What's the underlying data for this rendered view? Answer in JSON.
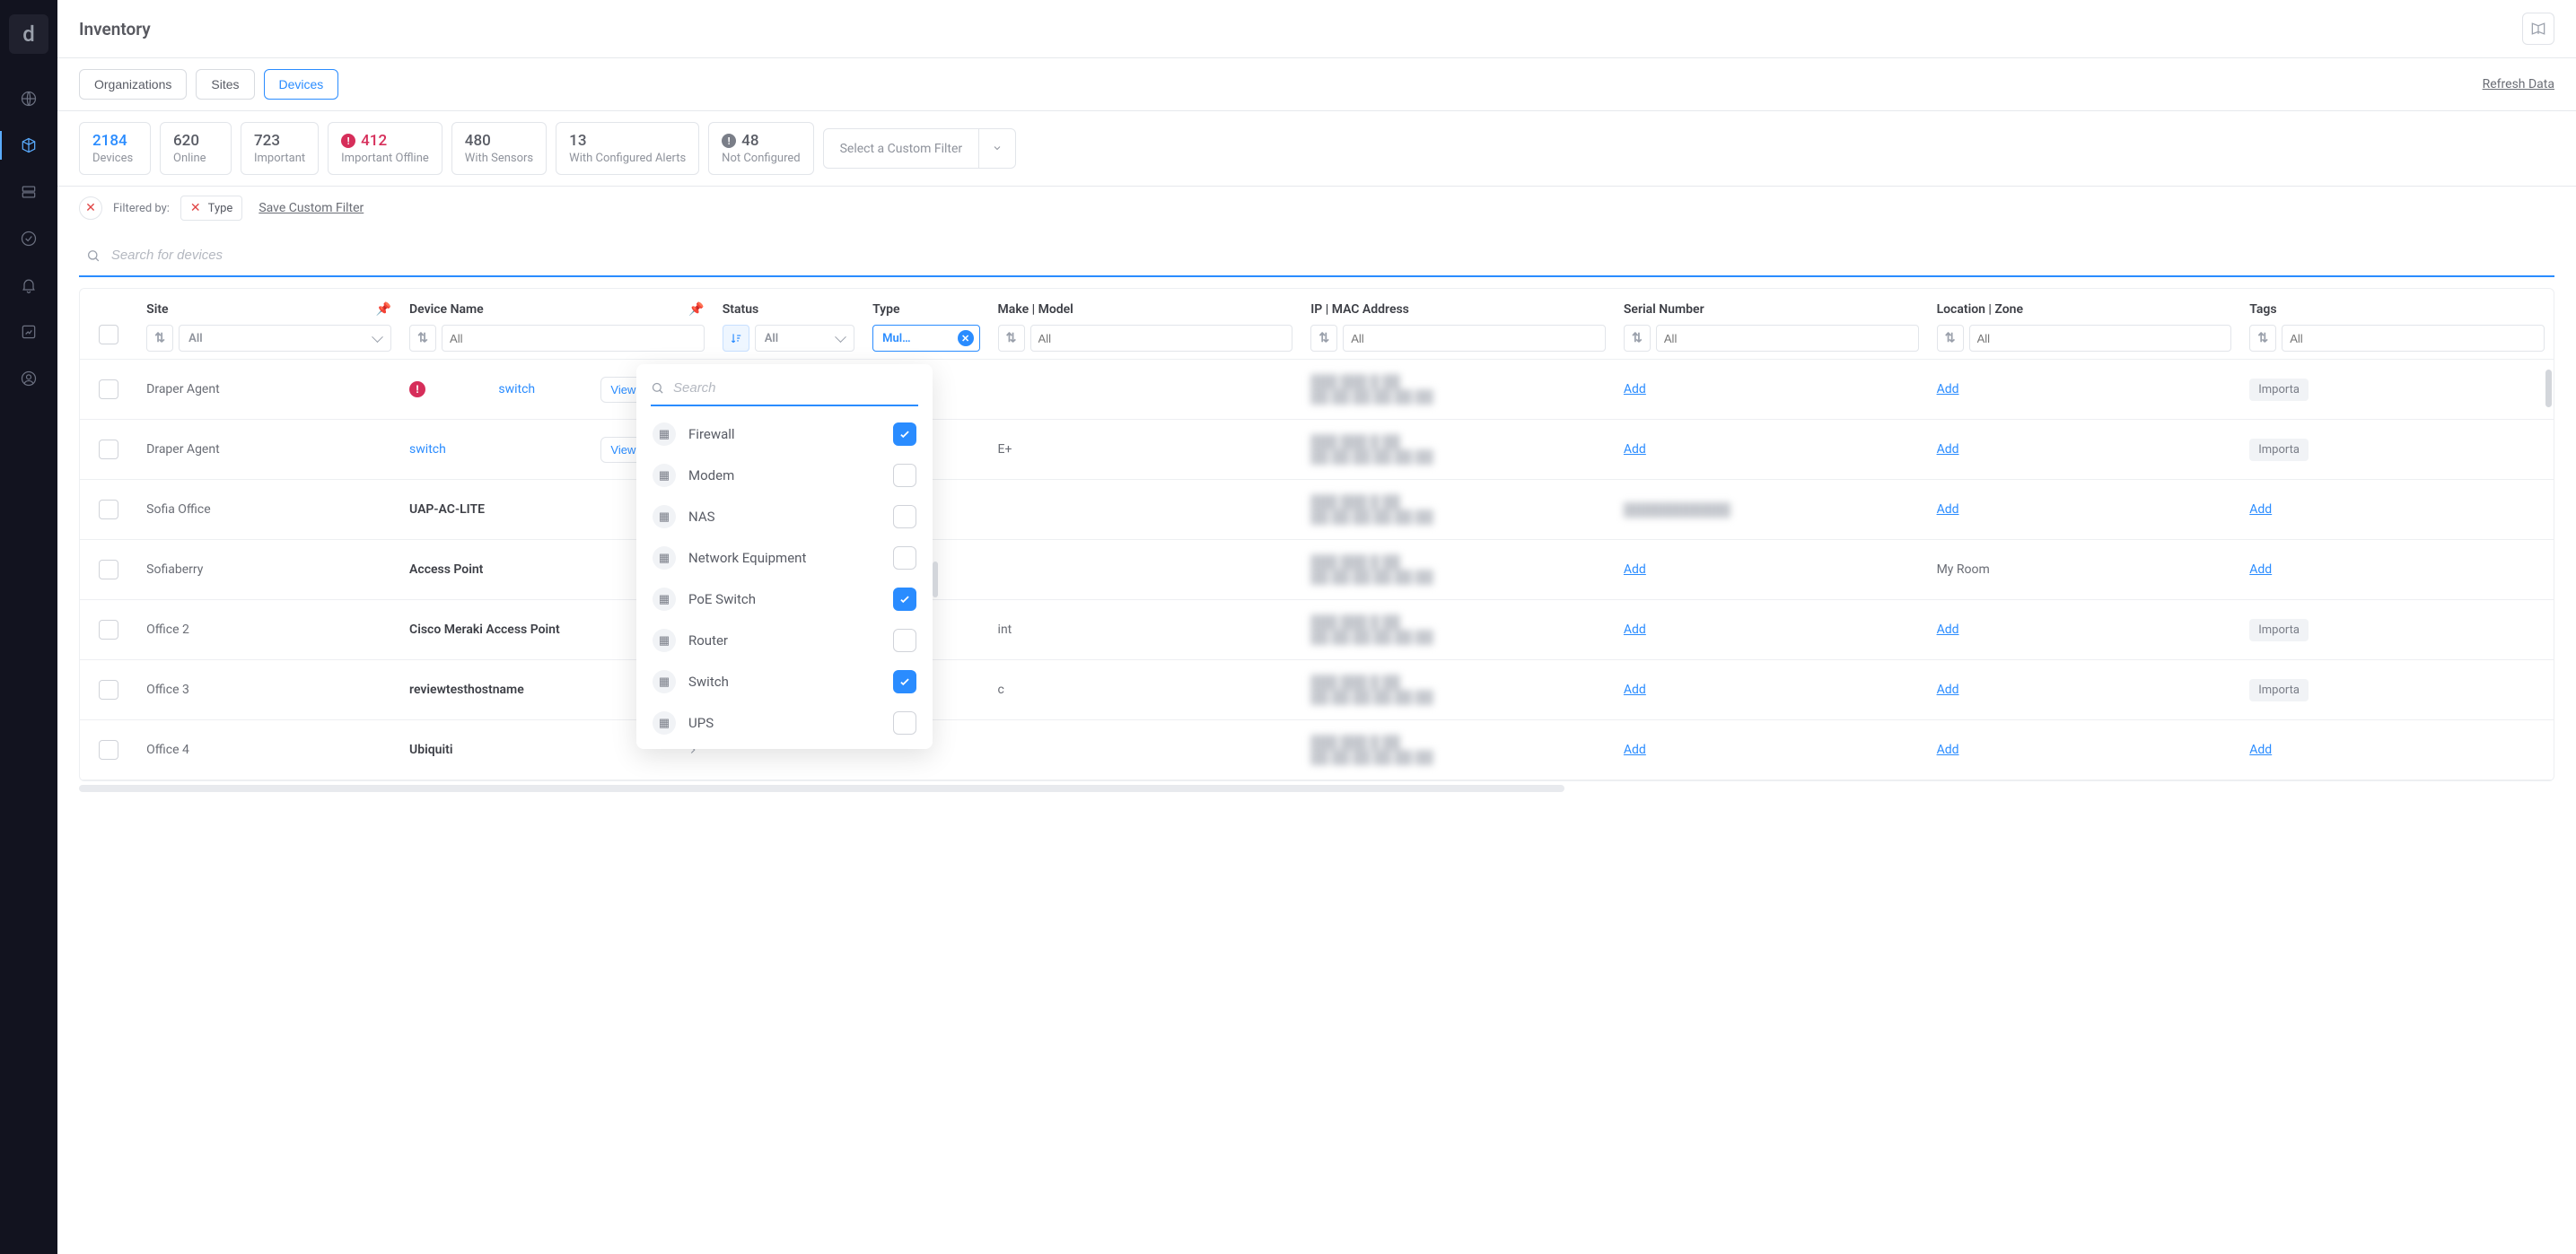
{
  "page": {
    "title": "Inventory",
    "refresh": "Refresh Data"
  },
  "tabs": {
    "organizations": "Organizations",
    "sites": "Sites",
    "devices": "Devices"
  },
  "stats": {
    "devices": {
      "num": "2184",
      "label": "Devices"
    },
    "online": {
      "num": "620",
      "label": "Online"
    },
    "important": {
      "num": "723",
      "label": "Important"
    },
    "important_offline": {
      "num": "412",
      "label": "Important Offline"
    },
    "with_sensors": {
      "num": "480",
      "label": "With Sensors"
    },
    "with_alerts": {
      "num": "13",
      "label": "With Configured Alerts"
    },
    "not_configured": {
      "num": "48",
      "label": "Not Configured"
    }
  },
  "filter_dropdown": "Select a Custom Filter",
  "filter": {
    "filtered_by": "Filtered by:",
    "type_chip": "Type",
    "save": "Save Custom Filter"
  },
  "search_placeholder": "Search for devices",
  "columns": {
    "site": "Site",
    "device_name": "Device Name",
    "status": "Status",
    "type": "Type",
    "make_model": "Make | Model",
    "ip_mac": "IP | MAC Address",
    "serial": "Serial Number",
    "location": "Location | Zone",
    "tags": "Tags"
  },
  "col_filters": {
    "all": "All",
    "type_multi": "Mul…"
  },
  "view_details": "View Details",
  "add": "Add",
  "tag_important": "Importa",
  "rows": [
    {
      "site": "Draper Agent",
      "device": "switch",
      "link": true,
      "alert": true,
      "view": true,
      "make_partial": "",
      "serial_add": true,
      "loc_add": true,
      "tag": true
    },
    {
      "site": "Draper Agent",
      "device": "switch",
      "link": true,
      "alert": false,
      "view": true,
      "make_partial": "E+",
      "serial_add": true,
      "loc_add": true,
      "tag": true
    },
    {
      "site": "Sofia Office",
      "device": "UAP-AC-LITE",
      "link": false,
      "alert": false,
      "view": false,
      "make_partial": "",
      "serial_blur": true,
      "loc_add": true,
      "tag_add": true
    },
    {
      "site": "Sofiaberry",
      "device": "Access Point",
      "link": false,
      "alert": false,
      "view": false,
      "make_partial": "",
      "serial_add": true,
      "loc_text": "My Room",
      "tag_add": true
    },
    {
      "site": "Office 2",
      "device": "Cisco Meraki Access Point",
      "link": false,
      "alert": false,
      "view": false,
      "make_partial": "int",
      "serial_add": true,
      "loc_add": true,
      "tag": true
    },
    {
      "site": "Office 3",
      "device": "reviewtesthostname",
      "link": false,
      "alert": false,
      "view": false,
      "make_partial": "c",
      "serial_add": true,
      "loc_add": true,
      "tag": true
    },
    {
      "site": "Office 4",
      "device": "Ubiquiti",
      "link": false,
      "alert": false,
      "view": false,
      "make_partial": "",
      "serial_add": true,
      "loc_add": true,
      "tag_add": true
    }
  ],
  "type_dropdown": {
    "search_placeholder": "Search",
    "items": [
      {
        "label": "Firewall",
        "checked": true
      },
      {
        "label": "Modem",
        "checked": false
      },
      {
        "label": "NAS",
        "checked": false
      },
      {
        "label": "Network Equipment",
        "checked": false
      },
      {
        "label": "PoE Switch",
        "checked": true
      },
      {
        "label": "Router",
        "checked": false
      },
      {
        "label": "Switch",
        "checked": true
      },
      {
        "label": "UPS",
        "checked": false
      }
    ]
  }
}
